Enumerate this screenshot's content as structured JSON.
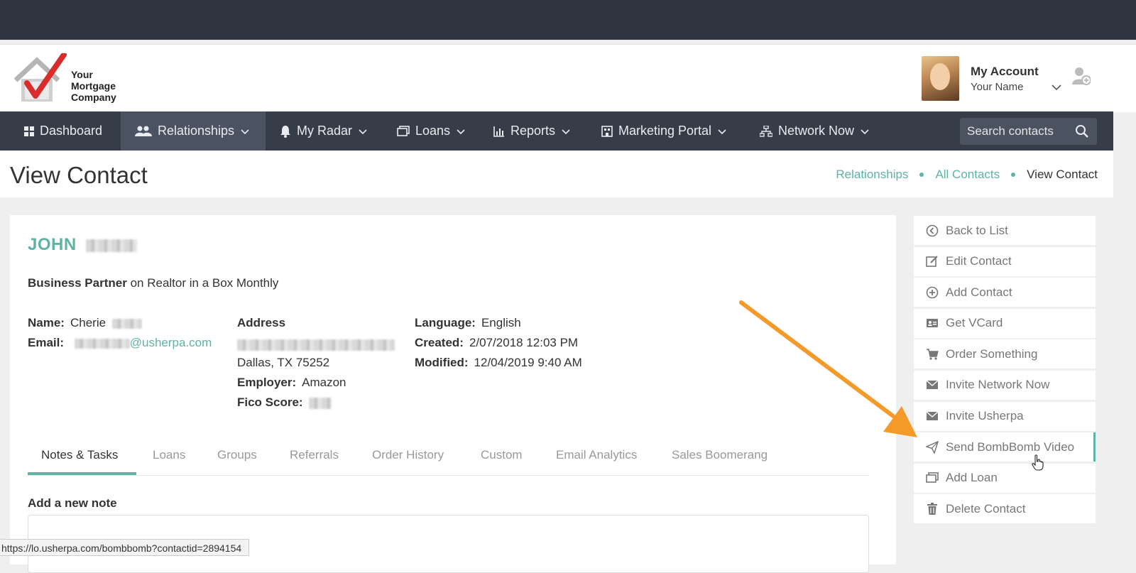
{
  "brand": {
    "logo_text_line1": "Your",
    "logo_text_line2": "Mortgage",
    "logo_text_line3": "Company",
    "accent": "#5db3a4",
    "logo_red": "#d92c2c"
  },
  "account": {
    "title": "My Account",
    "name": "Your Name"
  },
  "nav": {
    "items": [
      {
        "label": "Dashboard",
        "icon": "dashboard-icon"
      },
      {
        "label": "Relationships",
        "icon": "people-icon",
        "active": true
      },
      {
        "label": "My Radar",
        "icon": "bell-icon"
      },
      {
        "label": "Loans",
        "icon": "loans-icon"
      },
      {
        "label": "Reports",
        "icon": "bar-chart-icon"
      },
      {
        "label": "Marketing Portal",
        "icon": "building-icon"
      },
      {
        "label": "Network Now",
        "icon": "network-icon"
      }
    ],
    "search_placeholder": "Search contacts"
  },
  "page": {
    "title": "View Contact",
    "breadcrumb": [
      "Relationships",
      "All Contacts",
      "View Contact"
    ]
  },
  "contact": {
    "first_name": "JOHN",
    "role": "Business Partner",
    "role_suffix": "on Realtor in a Box Monthly",
    "name_label": "Name:",
    "name_value": "Cherie",
    "email_label": "Email:",
    "email_domain": "@usherpa.com",
    "address_label": "Address",
    "city_line": "Dallas, TX 75252",
    "employer_label": "Employer:",
    "employer_value": "Amazon",
    "fico_label": "Fico Score:",
    "language_label": "Language:",
    "language_value": "English",
    "created_label": "Created:",
    "created_value": "2/07/2018 12:03 PM",
    "modified_label": "Modified:",
    "modified_value": "12/04/2019 9:40 AM"
  },
  "tabs": [
    "Notes & Tasks",
    "Loans",
    "Groups",
    "Referrals",
    "Order History",
    "Custom",
    "Email Analytics",
    "Sales Boomerang"
  ],
  "notes": {
    "add_label": "Add a new note"
  },
  "status_bar": {
    "url": "https://lo.usherpa.com/bombbomb?contactid=2894154"
  },
  "actions": [
    {
      "label": "Back to List",
      "icon": "circle-arrow-left-icon"
    },
    {
      "label": "Edit Contact",
      "icon": "edit-icon"
    },
    {
      "label": "Add Contact",
      "icon": "plus-circle-icon"
    },
    {
      "label": "Get VCard",
      "icon": "vcard-icon"
    },
    {
      "label": "Order Something",
      "icon": "cart-icon"
    },
    {
      "label": "Invite Network Now",
      "icon": "envelope-icon"
    },
    {
      "label": "Invite Usherpa",
      "icon": "envelope-icon"
    },
    {
      "label": "Send BombBomb Video",
      "icon": "paper-plane-icon"
    },
    {
      "label": "Add Loan",
      "icon": "loans-icon"
    },
    {
      "label": "Delete Contact",
      "icon": "trash-icon"
    }
  ],
  "annotation": {
    "arrow_color": "#f39a2a"
  }
}
